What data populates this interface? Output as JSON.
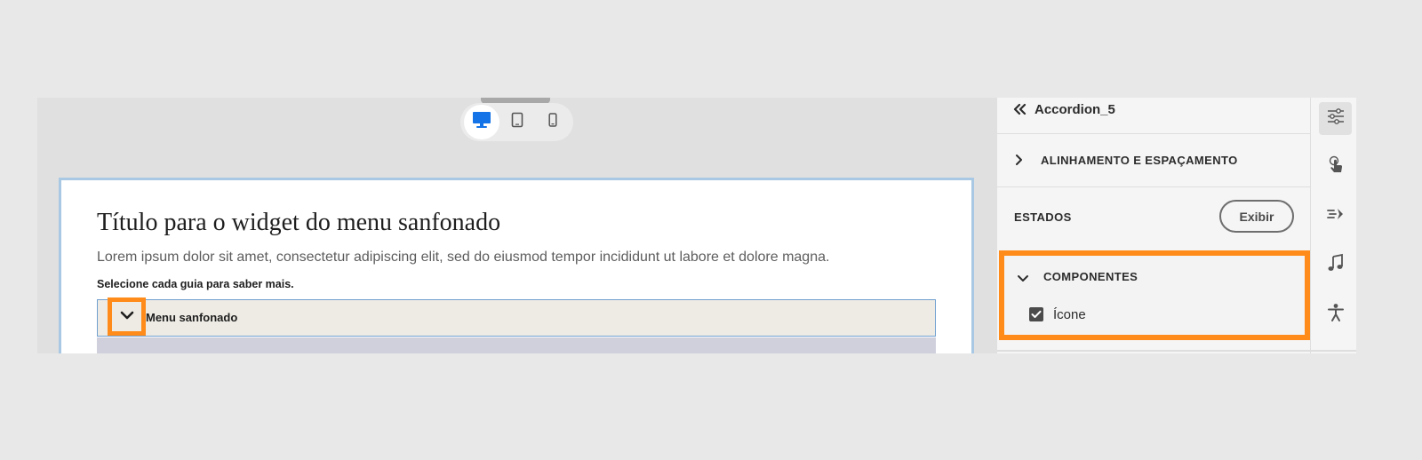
{
  "canvas": {
    "device_toggle": {
      "items": [
        {
          "name": "desktop-icon",
          "active": true
        },
        {
          "name": "tablet-icon",
          "active": false
        },
        {
          "name": "mobile-icon",
          "active": false
        }
      ]
    },
    "widget": {
      "title": "Título para o widget do menu sanfonado",
      "description": "Lorem ipsum dolor sit amet, consectetur adipiscing elit, sed do eiusmod tempor incididunt ut labore et dolore magna.",
      "hint": "Selecione cada guia para saber mais.",
      "accordion": {
        "label": "Menu sanfonado",
        "icon": "chevron-down-icon"
      }
    }
  },
  "props": {
    "title": "Accordion_5",
    "back_icon": "double-chevron-left-icon",
    "sections": {
      "alignment": {
        "label": "ALINHAMENTO E ESPAÇAMENTO",
        "expanded": false
      },
      "states": {
        "label": "ESTADOS",
        "button_label": "Exibir"
      },
      "components": {
        "label": "COMPONENTES",
        "expanded": true,
        "items": [
          {
            "label": "Ícone",
            "checked": true
          }
        ]
      }
    }
  },
  "rail": {
    "items": [
      {
        "name": "properties-sliders-icon",
        "active": true
      },
      {
        "name": "interaction-touch-icon",
        "active": false
      },
      {
        "name": "effects-icon",
        "active": false
      },
      {
        "name": "audio-note-icon",
        "active": false
      },
      {
        "name": "accessibility-icon",
        "active": false
      }
    ]
  },
  "colors": {
    "highlight": "#ff8c1a",
    "accent_blue": "#1473e6",
    "stage_border": "#a9c8e3"
  }
}
